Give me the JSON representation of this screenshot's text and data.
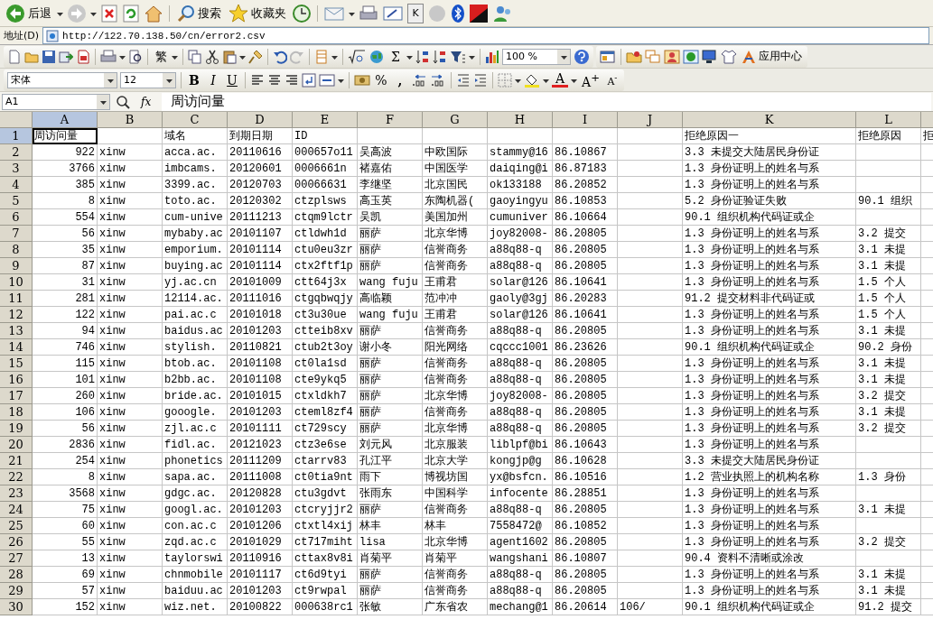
{
  "browser_toolbar": {
    "back_label": "后退",
    "search_label": "搜索",
    "favorites_label": "收藏夹",
    "key_label": "K"
  },
  "address_bar": {
    "label": "地址(D)",
    "url": "http://122.70.138.50/cn/error2.csv"
  },
  "standard_toolbar": {
    "traditional_label": "繁",
    "sum_label": "Σ",
    "zoom": "100 %",
    "app_center_label": "应用中心"
  },
  "format_toolbar": {
    "font": "宋体",
    "size": "12",
    "bold": "B",
    "italic": "I",
    "underline": "U",
    "percent": "%",
    "comma": ",",
    "font_color": "A",
    "grow_font": "A$^{+}$",
    "shrink_font": "A$^{-}$"
  },
  "formula_bar": {
    "cell": "A1",
    "fx": "fx",
    "content": "周访问量"
  },
  "sheet": {
    "columns": [
      {
        "label": "A",
        "selected": true,
        "kind": "number"
      },
      {
        "label": "B",
        "selected": false,
        "kind": "text"
      },
      {
        "label": "C",
        "selected": false,
        "kind": "text"
      },
      {
        "label": "D",
        "selected": false,
        "kind": "text"
      },
      {
        "label": "E",
        "selected": false,
        "kind": "text"
      },
      {
        "label": "F",
        "selected": false,
        "kind": "text"
      },
      {
        "label": "G",
        "selected": false,
        "kind": "text"
      },
      {
        "label": "H",
        "selected": false,
        "kind": "text"
      },
      {
        "label": "I",
        "selected": false,
        "kind": "text"
      },
      {
        "label": "J",
        "selected": false,
        "kind": "text"
      },
      {
        "label": "K",
        "selected": false,
        "kind": "text"
      },
      {
        "label": "L",
        "selected": false,
        "kind": "text"
      }
    ],
    "rows": [
      {
        "number": "1",
        "selected": true,
        "cells": {
          "A": "周访问量",
          "C": "域名",
          "D": "到期日期",
          "E": "ID",
          "K": "拒绝原因一",
          "L": "拒绝原因",
          "column_13": "拒"
        }
      },
      {
        "number": "2",
        "selected": false,
        "cells": {
          "A": "922",
          "B": "xinw",
          "C": "acca.ac.",
          "D": "20110616",
          "E": "000657o11",
          "F": "吴高波",
          "G": "中欧国际",
          "H": "stammy@16",
          "I": "86.10867",
          "K": "3.3 未提交大陆居民身份证"
        }
      },
      {
        "number": "3",
        "selected": false,
        "cells": {
          "A": "3766",
          "B": "xinw",
          "C": "imbcams.",
          "D": "20120601",
          "E": "0006661n",
          "F": "褚嘉佑",
          "G": "中国医学",
          "H": "daiqing@i",
          "I": "86.87183",
          "K": "1.3 身份证明上的姓名与系"
        }
      },
      {
        "number": "4",
        "selected": false,
        "cells": {
          "A": "385",
          "B": "xinw",
          "C": "3399.ac.",
          "D": "20120703",
          "E": "00066631",
          "F": "李继坚",
          "G": "北京国民",
          "H": "ok133188",
          "I": "86.20852",
          "K": "1.3 身份证明上的姓名与系"
        }
      },
      {
        "number": "5",
        "selected": false,
        "cells": {
          "A": "8",
          "B": "xinw",
          "C": "toto.ac.",
          "D": "20120302",
          "E": "ctzplsws",
          "F": "高玉英",
          "G": "东陶机器(",
          "H": "gaoyingyu",
          "I": "86.10853",
          "K": "5.2 身份证验证失败",
          "L": "90.1 组织"
        }
      },
      {
        "number": "6",
        "selected": false,
        "cells": {
          "A": "554",
          "B": "xinw",
          "C": "cum-unive",
          "D": "20111213",
          "E": "ctqm9lctr",
          "F": "吴凯",
          "G": "美国加州",
          "H": "cumuniver",
          "I": "86.10664",
          "K": "90.1 组织机构代码证或企"
        }
      },
      {
        "number": "7",
        "selected": false,
        "cells": {
          "A": "56",
          "B": "xinw",
          "C": "mybaby.ac",
          "D": "20101107",
          "E": "ctldwh1d",
          "F": "丽萨",
          "G": "北京华博",
          "H": "joy82008-",
          "I": "86.20805",
          "K": "1.3 身份证明上的姓名与系",
          "L": "3.2 提交"
        }
      },
      {
        "number": "8",
        "selected": false,
        "cells": {
          "A": "35",
          "B": "xinw",
          "C": "emporium.",
          "D": "20101114",
          "E": "ctu0eu3zr",
          "F": "丽萨",
          "G": "信誉商务",
          "H": "a88q88-q",
          "I": "86.20805",
          "K": "1.3 身份证明上的姓名与系",
          "L": "3.1 未提"
        }
      },
      {
        "number": "9",
        "selected": false,
        "cells": {
          "A": "87",
          "B": "xinw",
          "C": "buying.ac",
          "D": "20101114",
          "E": "ctx2ftf1p",
          "F": "丽萨",
          "G": "信誉商务",
          "H": "a88q88-q",
          "I": "86.20805",
          "K": "1.3 身份证明上的姓名与系",
          "L": "3.1 未提"
        }
      },
      {
        "number": "10",
        "selected": false,
        "cells": {
          "A": "31",
          "B": "xinw",
          "C": "yj.ac.cn",
          "D": "20101009",
          "E": "ctt64j3x",
          "F": "wang fuju",
          "G": "王甫君",
          "H": "solar@126",
          "I": "86.10641",
          "K": "1.3 身份证明上的姓名与系",
          "L": "1.5 个人"
        }
      },
      {
        "number": "11",
        "selected": false,
        "cells": {
          "A": "281",
          "B": "xinw",
          "C": "12114.ac.",
          "D": "20111016",
          "E": "ctgqbwqjy",
          "F": "高临颖",
          "G": "范冲冲",
          "H": "gaoly@3gj",
          "I": "86.20283",
          "K": "91.2 提交材料非代码证或",
          "L": "1.5 个人"
        }
      },
      {
        "number": "12",
        "selected": false,
        "cells": {
          "A": "122",
          "B": "xinw",
          "C": "pai.ac.c",
          "D": "20101018",
          "E": "ct3u30ue",
          "F": "wang fuju",
          "G": "王甫君",
          "H": "solar@126",
          "I": "86.10641",
          "K": "1.3 身份证明上的姓名与系",
          "L": "1.5 个人"
        }
      },
      {
        "number": "13",
        "selected": false,
        "cells": {
          "A": "94",
          "B": "xinw",
          "C": "baidus.ac",
          "D": "20101203",
          "E": "ctteib8xv",
          "F": "丽萨",
          "G": "信誉商务",
          "H": "a88q88-q",
          "I": "86.20805",
          "K": "1.3 身份证明上的姓名与系",
          "L": "3.1 未提"
        }
      },
      {
        "number": "14",
        "selected": false,
        "cells": {
          "A": "746",
          "B": "xinw",
          "C": "stylish.",
          "D": "20110821",
          "E": "ctub2t3oy",
          "F": "谢小冬",
          "G": "阳光网络",
          "H": "cqccc1001",
          "I": "86.23626",
          "K": "90.1 组织机构代码证或企",
          "L": "90.2 身份"
        }
      },
      {
        "number": "15",
        "selected": false,
        "cells": {
          "A": "115",
          "B": "xinw",
          "C": "btob.ac.",
          "D": "20101108",
          "E": "ct0la1sd",
          "F": "丽萨",
          "G": "信誉商务",
          "H": "a88q88-q",
          "I": "86.20805",
          "K": "1.3 身份证明上的姓名与系",
          "L": "3.1 未提"
        }
      },
      {
        "number": "16",
        "selected": false,
        "cells": {
          "A": "101",
          "B": "xinw",
          "C": "b2bb.ac.",
          "D": "20101108",
          "E": "cte9ykq5",
          "F": "丽萨",
          "G": "信誉商务",
          "H": "a88q88-q",
          "I": "86.20805",
          "K": "1.3 身份证明上的姓名与系",
          "L": "3.1 未提"
        }
      },
      {
        "number": "17",
        "selected": false,
        "cells": {
          "A": "260",
          "B": "xinw",
          "C": "bride.ac.",
          "D": "20101015",
          "E": "ctxldkh7",
          "F": "丽萨",
          "G": "北京华博",
          "H": "joy82008-",
          "I": "86.20805",
          "K": "1.3 身份证明上的姓名与系",
          "L": "3.2 提交"
        }
      },
      {
        "number": "18",
        "selected": false,
        "cells": {
          "A": "106",
          "B": "xinw",
          "C": "gooogle.",
          "D": "20101203",
          "E": "cteml8zf4",
          "F": "丽萨",
          "G": "信誉商务",
          "H": "a88q88-q",
          "I": "86.20805",
          "K": "1.3 身份证明上的姓名与系",
          "L": "3.1 未提"
        }
      },
      {
        "number": "19",
        "selected": false,
        "cells": {
          "A": "56",
          "B": "xinw",
          "C": "zjl.ac.c",
          "D": "20101111",
          "E": "ct729scy",
          "F": "丽萨",
          "G": "北京华博",
          "H": "a88q88-q",
          "I": "86.20805",
          "K": "1.3 身份证明上的姓名与系",
          "L": "3.2 提交"
        }
      },
      {
        "number": "20",
        "selected": false,
        "cells": {
          "A": "2836",
          "B": "xinw",
          "C": "fidl.ac.",
          "D": "20121023",
          "E": "ctz3e6se",
          "F": "刘元风",
          "G": "北京服装",
          "H": "liblpf@bi",
          "I": "86.10643",
          "K": "1.3 身份证明上的姓名与系"
        }
      },
      {
        "number": "21",
        "selected": false,
        "cells": {
          "A": "254",
          "B": "xinw",
          "C": "phonetics",
          "D": "20111209",
          "E": "ctarrv83",
          "F": "孔江平",
          "G": "北京大学",
          "H": "kongjp@g",
          "I": "86.10628",
          "K": "3.3 未提交大陆居民身份证"
        }
      },
      {
        "number": "22",
        "selected": false,
        "cells": {
          "A": "8",
          "B": "xinw",
          "C": "sapa.ac.",
          "D": "20111008",
          "E": "ct0tia9nt",
          "F": "雨下",
          "G": "博视坊国",
          "H": "yx@bsfcn.",
          "I": "86.10516",
          "K": "1.2 营业执照上的机构名称",
          "L": "1.3 身份"
        }
      },
      {
        "number": "23",
        "selected": false,
        "cells": {
          "A": "3568",
          "B": "xinw",
          "C": "gdgc.ac.",
          "D": "20120828",
          "E": "ctu3gdvt",
          "F": "张雨东",
          "G": "中国科学",
          "H": "infocente",
          "I": "86.28851",
          "K": "1.3 身份证明上的姓名与系"
        }
      },
      {
        "number": "24",
        "selected": false,
        "cells": {
          "A": "75",
          "B": "xinw",
          "C": "googl.ac.",
          "D": "20101203",
          "E": "ctcryjjr2",
          "F": "丽萨",
          "G": "信誉商务",
          "H": "a88q88-q",
          "I": "86.20805",
          "K": "1.3 身份证明上的姓名与系",
          "L": "3.1 未提"
        }
      },
      {
        "number": "25",
        "selected": false,
        "cells": {
          "A": "60",
          "B": "xinw",
          "C": "con.ac.c",
          "D": "20101206",
          "E": "ctxtl4xij",
          "F": "林丰",
          "G": "林丰",
          "H": "7558472@",
          "I": "86.10852",
          "K": "1.3 身份证明上的姓名与系"
        }
      },
      {
        "number": "26",
        "selected": false,
        "cells": {
          "A": "55",
          "B": "xinw",
          "C": "zqd.ac.c",
          "D": "20101029",
          "E": "ct717miht",
          "F": "lisa",
          "G": "北京华博",
          "H": "agent1602",
          "I": "86.20805",
          "K": "1.3 身份证明上的姓名与系",
          "L": "3.2 提交"
        }
      },
      {
        "number": "27",
        "selected": false,
        "cells": {
          "A": "13",
          "B": "xinw",
          "C": "taylorswi",
          "D": "20110916",
          "E": "cttax8v8i",
          "F": "肖菊平",
          "G": "肖菊平",
          "H": "wangshani",
          "I": "86.10807",
          "K": "90.4 资料不清晰或涂改"
        }
      },
      {
        "number": "28",
        "selected": false,
        "cells": {
          "A": "69",
          "B": "xinw",
          "C": "chnmobile",
          "D": "20101117",
          "E": "ct6d9tyi",
          "F": "丽萨",
          "G": "信誉商务",
          "H": "a88q88-q",
          "I": "86.20805",
          "K": "1.3 身份证明上的姓名与系",
          "L": "3.1 未提"
        }
      },
      {
        "number": "29",
        "selected": false,
        "cells": {
          "A": "57",
          "B": "xinw",
          "C": "baiduu.ac",
          "D": "20101203",
          "E": "ct9rwpal",
          "F": "丽萨",
          "G": "信誉商务",
          "H": "a88q88-q",
          "I": "86.20805",
          "K": "1.3 身份证明上的姓名与系",
          "L": "3.1 未提"
        }
      },
      {
        "number": "30",
        "selected": false,
        "cells": {
          "A": "152",
          "B": "xinw",
          "C": "wiz.net.",
          "D": "20100822",
          "E": "000638rc1",
          "F": "张敏",
          "G": "广东省农",
          "H": "mechang@1",
          "I": "86.20614",
          "J": "106/",
          "K": "90.1 组织机构代码证或企",
          "L": "91.2 提交"
        }
      }
    ]
  }
}
